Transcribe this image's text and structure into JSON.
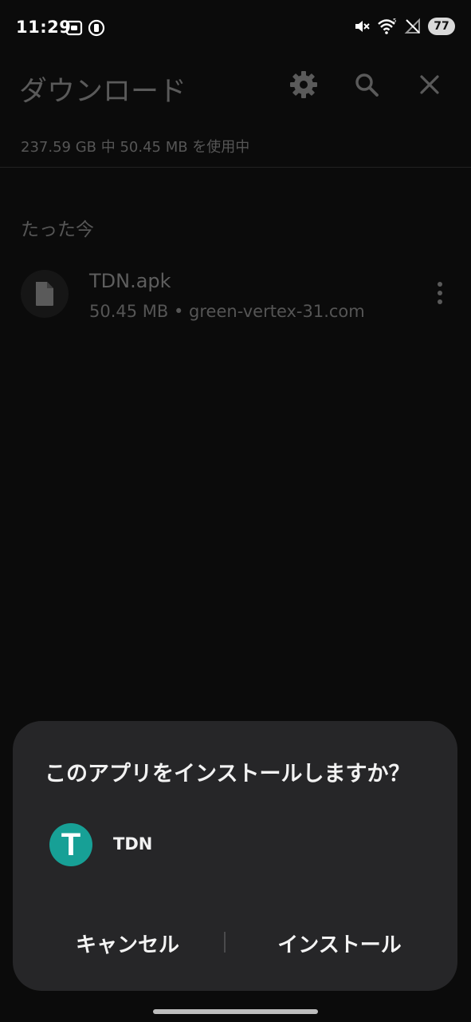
{
  "status_bar": {
    "time": "11:29",
    "battery_level": "77",
    "left_icons": [
      "screen-record-icon",
      "nfc-icon"
    ],
    "right_icons": [
      "mute-icon",
      "wifi-icon",
      "no-signal-icon",
      "battery-icon"
    ]
  },
  "app": {
    "title": "ダウンロード",
    "toolbar_icons": [
      "gear-icon",
      "search-icon",
      "close-icon"
    ],
    "storage_text": "237.59 GB 中 50.45 MB を使用中",
    "section_header": "たった今",
    "files": [
      {
        "name": "TDN.apk",
        "meta": "50.45 MB • green-vertex-31.com"
      }
    ]
  },
  "dialog": {
    "title": "このアプリをインストールしますか？",
    "app_icon_letter": "T",
    "app_icon_color": "#17a096",
    "app_name": "TDN",
    "cancel_label": "キャンセル",
    "install_label": "インストール"
  }
}
